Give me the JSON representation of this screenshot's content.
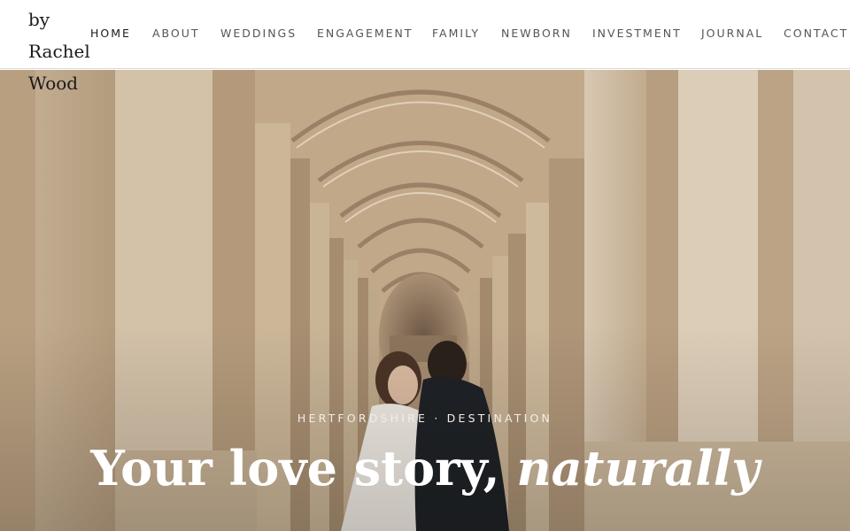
{
  "brand": {
    "lines": [
      "by",
      "Rachel",
      "Wood"
    ]
  },
  "nav": {
    "items": [
      {
        "label": "HOME",
        "active": true
      },
      {
        "label": "ABOUT",
        "active": false
      },
      {
        "label": "WEDDINGS",
        "active": false
      },
      {
        "label": "ENGAGEMENT",
        "active": false
      },
      {
        "label": "FAMILY",
        "active": false
      },
      {
        "label": "NEWBORN",
        "active": false
      },
      {
        "label": "INVESTMENT",
        "active": false
      },
      {
        "label": "JOURNAL",
        "active": false
      },
      {
        "label": "CONTACT",
        "active": false
      }
    ]
  },
  "hero": {
    "eyebrow": "HERTFORDSHIRE · DESTINATION",
    "headline_plain": "Your love story, ",
    "headline_italic": "naturally"
  },
  "colors": {
    "header_bg": "#ffffff",
    "nav_text": "#555555",
    "nav_active": "#1a1a1a",
    "hero_text": "#ffffff",
    "stone": "#cbb89d"
  }
}
